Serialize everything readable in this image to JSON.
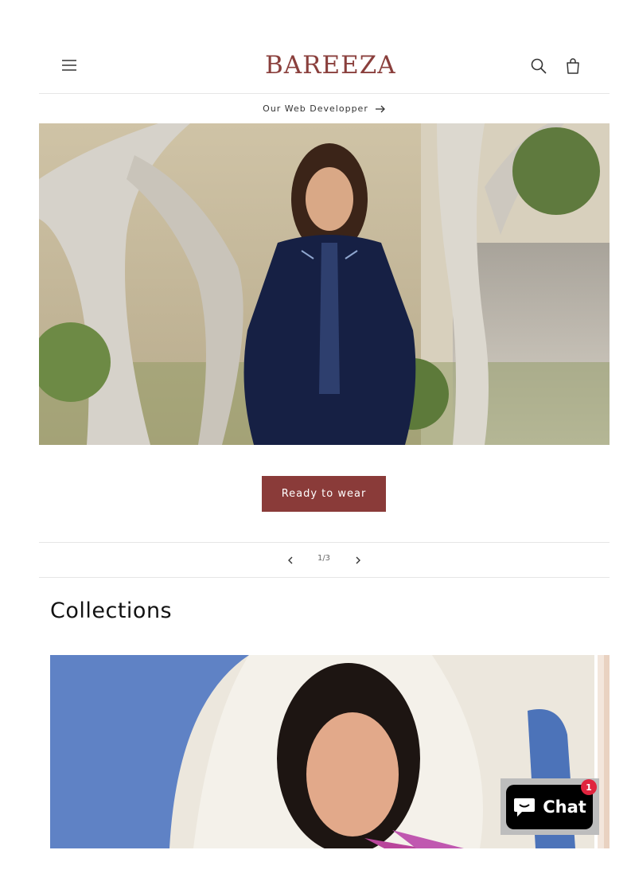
{
  "header": {
    "logo_text": "BAREEZA",
    "icons": [
      "menu-icon",
      "search-icon",
      "cart-icon"
    ]
  },
  "announcement": {
    "text": "Our Web Developper",
    "icon": "arrow-right-icon"
  },
  "hero": {
    "button_label": "Ready to wear"
  },
  "slider": {
    "counter": "1/3",
    "prev_icon": "chevron-left-icon",
    "next_icon": "chevron-right-icon"
  },
  "collections": {
    "title": "Collections"
  },
  "chat": {
    "label": "Chat",
    "badge_count": "1",
    "icon": "chat-bubble-icon"
  },
  "colors": {
    "brand": "#8a3b39",
    "chat_bg": "#000000",
    "badge": "#e0243e"
  }
}
